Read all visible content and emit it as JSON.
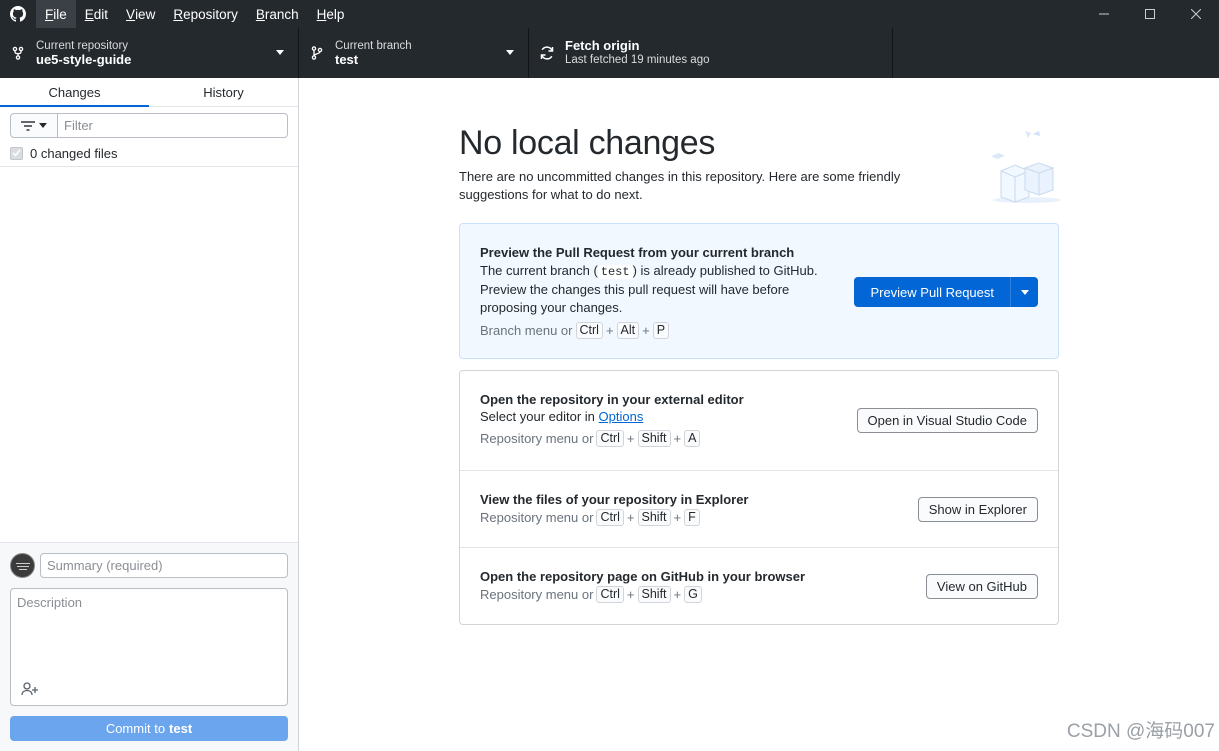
{
  "menu": {
    "items": [
      {
        "label": "File",
        "access": "F",
        "rest": "ile"
      },
      {
        "label": "Edit",
        "access": "E",
        "rest": "dit"
      },
      {
        "label": "View",
        "access": "V",
        "rest": "iew"
      },
      {
        "label": "Repository",
        "access": "R",
        "rest": "epository"
      },
      {
        "label": "Branch",
        "access": "B",
        "rest": "ranch"
      },
      {
        "label": "Help",
        "access": "H",
        "rest": "elp"
      }
    ]
  },
  "toolbar": {
    "repo_label": "Current repository",
    "repo_value": "ue5-style-guide",
    "branch_label": "Current branch",
    "branch_value": "test",
    "fetch_title": "Fetch origin",
    "fetch_subtitle": "Last fetched 19 minutes ago"
  },
  "sidebar": {
    "tabs": [
      "Changes",
      "History"
    ],
    "filter_placeholder": "Filter",
    "changed_files": "0 changed files",
    "summary_placeholder": "Summary (required)",
    "description_placeholder": "Description",
    "commit_prefix": "Commit to",
    "commit_branch": "test"
  },
  "main": {
    "headline": "No local changes",
    "subline": "There are no uncommitted changes in this repository. Here are some friendly suggestions for what to do next.",
    "pull_request": {
      "title": "Preview the Pull Request from your current branch",
      "desc_before": "The current branch (",
      "branch_code": "test",
      "desc_after": ") is already published to GitHub.",
      "desc_line2": "Preview the changes this pull request will have before proposing your changes.",
      "hint_prefix": "Branch menu or",
      "keys": [
        "Ctrl",
        "Alt",
        "P"
      ],
      "button": "Preview Pull Request"
    },
    "editor": {
      "title": "Open the repository in your external editor",
      "desc_prefix": "Select your editor in",
      "desc_link": "Options",
      "hint_prefix": "Repository menu or",
      "keys": [
        "Ctrl",
        "Shift",
        "A"
      ],
      "button": "Open in Visual Studio Code"
    },
    "explorer": {
      "title": "View the files of your repository in Explorer",
      "hint_prefix": "Repository menu or",
      "keys": [
        "Ctrl",
        "Shift",
        "F"
      ],
      "button": "Show in Explorer"
    },
    "github": {
      "title": "Open the repository page on GitHub in your browser",
      "hint_prefix": "Repository menu or",
      "keys": [
        "Ctrl",
        "Shift",
        "G"
      ],
      "button": "View on GitHub"
    }
  },
  "watermark": "CSDN @海码007"
}
